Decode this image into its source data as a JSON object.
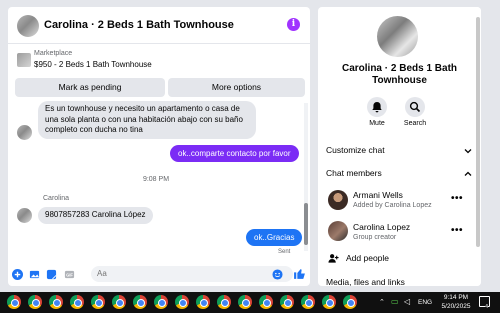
{
  "chat": {
    "title": "Carolina · 2 Beds 1 Bath Townhouse",
    "marketplace_label": "Marketplace",
    "listing": "$950 - 2 Beds 1 Bath Townhouse",
    "mark_pending_label": "Mark as pending",
    "more_options_label": "More options",
    "messages": [
      {
        "direction": "in",
        "text": "Es un townhouse y necesito un apartamento o casa de una sola planta o con una habitación abajo con su baño completo con ducha no tina"
      },
      {
        "direction": "out",
        "text": "ok..comparte contacto por favor"
      },
      {
        "direction": "ts",
        "text": "9:08 PM"
      },
      {
        "direction": "sender",
        "text": "Carolina"
      },
      {
        "direction": "in",
        "text": "9807857283 Carolina López"
      },
      {
        "direction": "out",
        "text": "ok..Gracias"
      },
      {
        "direction": "status",
        "text": "Sent"
      }
    ],
    "composer_placeholder": "Aa"
  },
  "info": {
    "title": "Carolina · 2 Beds 1 Bath Townhouse",
    "mute_label": "Mute",
    "search_label": "Search",
    "customize_label": "Customize chat",
    "members_label": "Chat members",
    "members": [
      {
        "name": "Armani Wells",
        "sub": "Added by Carolina Lopez"
      },
      {
        "name": "Carolina Lopez",
        "sub": "Group creator"
      }
    ],
    "add_people_label": "Add people",
    "media_label": "Media, files and links"
  },
  "taskbar": {
    "language": "ENG",
    "time": "9:14 PM",
    "date": "5/20/2025",
    "notification_count": "4"
  },
  "colors": {
    "accent": "#7b2cf5",
    "blue": "#1e74f4",
    "bubble_in": "#e4e6eb"
  }
}
